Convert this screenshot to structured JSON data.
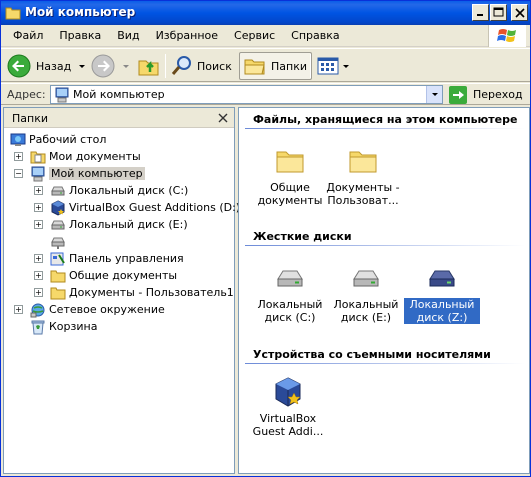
{
  "window": {
    "title": "Мой компьютер"
  },
  "menu": [
    "Файл",
    "Правка",
    "Вид",
    "Избранное",
    "Сервис",
    "Справка"
  ],
  "toolbar": {
    "back_label": "Назад",
    "search_label": "Поиск",
    "folders_label": "Папки"
  },
  "address": {
    "label": "Адрес:",
    "value": "Мой компьютер",
    "go_label": "Переход"
  },
  "folders_pane": {
    "title": "Папки",
    "tree": [
      {
        "label": "Рабочий стол",
        "icon": "desktop-icon"
      },
      {
        "label": "Мои документы",
        "icon": "my-documents-icon"
      },
      {
        "label": "Мой компьютер",
        "icon": "my-computer-icon"
      },
      {
        "label": "Локальный диск (C:)",
        "icon": "drive-icon"
      },
      {
        "label": "VirtualBox Guest Additions (D:)",
        "icon": "virtualbox-cd-icon"
      },
      {
        "label": "Локальный диск (E:)",
        "icon": "drive-icon"
      },
      {
        "label": "",
        "icon": "drive-icon"
      },
      {
        "label": "Панель управления",
        "icon": "control-panel-icon"
      },
      {
        "label": "Общие документы",
        "icon": "folder-icon"
      },
      {
        "label": "Документы - Пользователь1",
        "icon": "folder-icon"
      },
      {
        "label": "Сетевое окружение",
        "icon": "network-icon"
      },
      {
        "label": "Корзина",
        "icon": "recycle-bin-icon"
      }
    ]
  },
  "content": {
    "groups": [
      {
        "title": "Файлы, хранящиеся на этом компьютере",
        "items": [
          {
            "label": "Общие документы",
            "icon": "folder-icon"
          },
          {
            "label": "Документы - Пользоват...",
            "icon": "folder-icon"
          }
        ]
      },
      {
        "title": "Жесткие диски",
        "items": [
          {
            "label": "Локальный диск (C:)",
            "icon": "hard-drive-icon"
          },
          {
            "label": "Локальный диск (E:)",
            "icon": "hard-drive-icon"
          },
          {
            "label": "Локальный диск (Z:)",
            "icon": "hard-drive-dark-icon",
            "selected": true
          }
        ]
      },
      {
        "title": "Устройства со съемными носителями",
        "items": [
          {
            "label": "VirtualBox Guest Addi...",
            "icon": "virtualbox-cd-icon"
          }
        ]
      }
    ]
  },
  "colors": {
    "title_bar": "#0054e3",
    "selection": "#316ac5",
    "close_button": "#e0452a"
  }
}
